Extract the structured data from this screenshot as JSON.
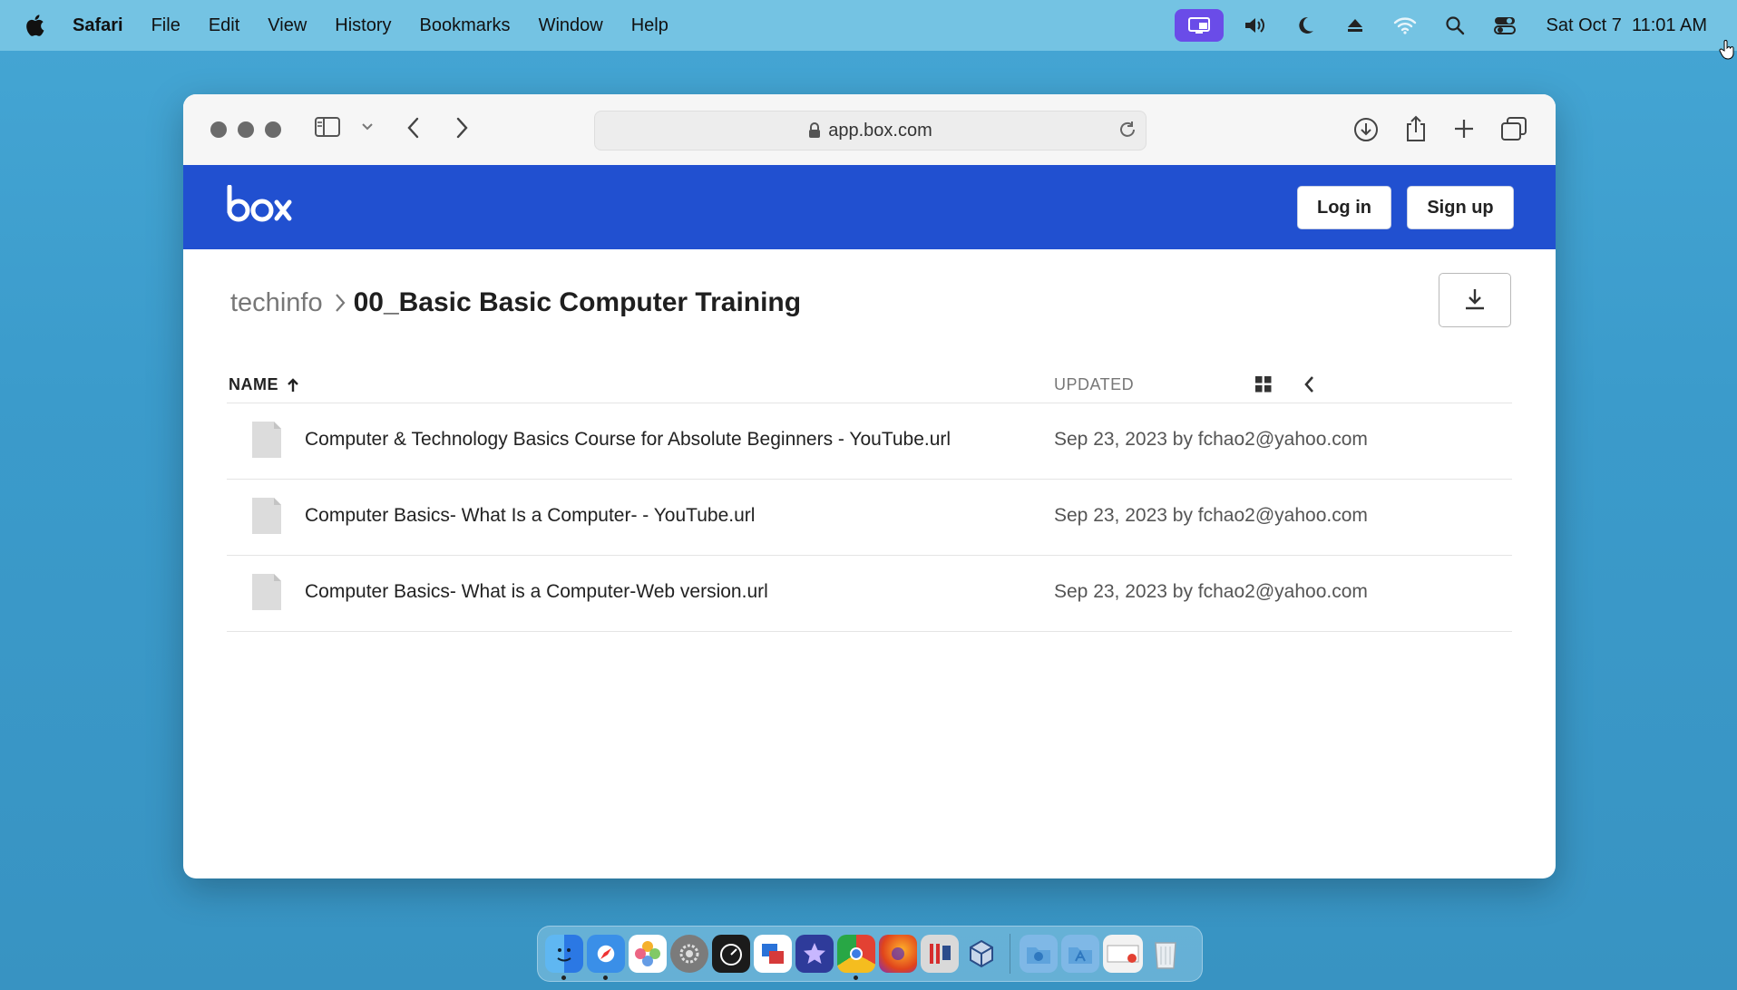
{
  "menubar": {
    "app_name": "Safari",
    "menus": [
      "File",
      "Edit",
      "View",
      "History",
      "Bookmarks",
      "Window",
      "Help"
    ],
    "status_icons": [
      "screen-sharing-icon",
      "volume-icon",
      "moon-icon",
      "eject-icon",
      "wifi-icon",
      "spotlight-search-icon",
      "control-center-icon"
    ],
    "clock": "Sat Oct 7  11:01 AM"
  },
  "browser": {
    "address": "app.box.com",
    "toolbar_icons": [
      "sidebar-icon",
      "chevron-down-icon",
      "back-icon",
      "forward-icon",
      "reload-icon",
      "downloads-icon",
      "share-icon",
      "new-tab-icon",
      "tab-overview-icon"
    ]
  },
  "box_header": {
    "logo": "box",
    "login_label": "Log in",
    "signup_label": "Sign up",
    "brand_color": "#2150d0"
  },
  "breadcrumb": {
    "parent": "techinfo",
    "current": "00_Basic Basic Computer Training"
  },
  "table": {
    "col_name": "NAME",
    "col_updated": "UPDATED",
    "sort": "ascending",
    "rows": [
      {
        "name": "Computer & Technology Basics Course for Absolute Beginners - YouTube.url",
        "updated": "Sep 23, 2023 by fchao2@yahoo.com"
      },
      {
        "name": "Computer Basics- What Is a Computer- - YouTube.url",
        "updated": "Sep 23, 2023 by fchao2@yahoo.com"
      },
      {
        "name": "Computer Basics- What is a Computer-Web version.url",
        "updated": "Sep 23, 2023 by fchao2@yahoo.com"
      }
    ]
  },
  "dock": {
    "apps": [
      "finder",
      "safari",
      "photos",
      "system-preferences",
      "activity-monitor",
      "screen-sharing",
      "imovie",
      "chrome",
      "firefox",
      "parallels",
      "virtualbox"
    ],
    "folders": [
      "downloads-folder",
      "applications-folder",
      "chrome-window",
      "trash"
    ]
  }
}
